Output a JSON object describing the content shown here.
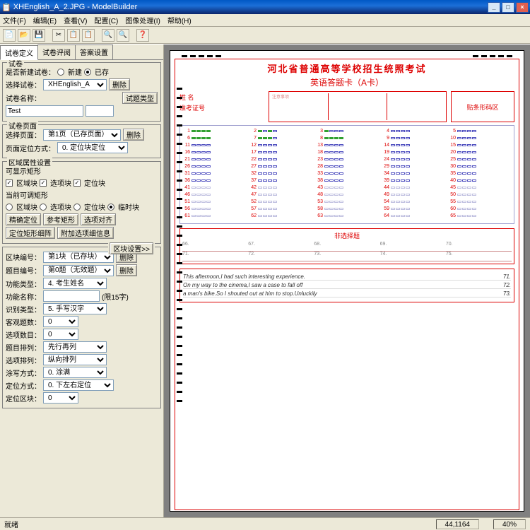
{
  "title": "XHEnglish_A_2.JPG - ModelBuilder",
  "menu": [
    "文件(F)",
    "编辑(E)",
    "查看(V)",
    "配置(C)",
    "图像处理(I)",
    "帮助(H)"
  ],
  "toolbar_icons": [
    "📄",
    "📂",
    "💾",
    "",
    "✂",
    "📋",
    "📋",
    "",
    "🔍",
    "🔍",
    "",
    "❓"
  ],
  "tabs": [
    "试卷定义",
    "试卷评阅",
    "答案设置"
  ],
  "active_tab": 0,
  "panel": {
    "g1": {
      "legend": "试卷",
      "l_new": "是否新建试卷：",
      "r_new": "新建",
      "r_exist": "已存",
      "l_sel": "选择试卷：",
      "sel": "XHEnglish_A",
      "btn_del": "删除",
      "l_name": "试卷名称：",
      "name": "Test",
      "btn_type": "试题类型"
    },
    "g2": {
      "legend": "试卷页面",
      "l_sel": "选择页面：",
      "sel": "第1页（已存页面）",
      "btn_del": "删除",
      "l_pos": "页面定位方式：",
      "pos": "0. 定位块定位"
    },
    "g3": {
      "legend": "区域属性设置",
      "l_show": "可显示矩形",
      "c1": "区域块",
      "c2": "选项块",
      "c3": "定位块",
      "l_adj": "当前可调矩形",
      "r1": "区域块",
      "r2": "选项块",
      "r3": "定位块",
      "r4": "临时块",
      "b1": "精确定位",
      "b2": "参考矩形",
      "b3": "选项对齐",
      "b4": "定位矩形细阵",
      "b5": "附加选项细信息"
    },
    "g4": {
      "btn_set": "区块设置>>",
      "l_block": "区块编号：",
      "block": "第1块（已存块）",
      "btn_del": "删除",
      "l_q": "题目编号：",
      "q": "第0题（无效题）",
      "btn_del2": "删除",
      "l_ftype": "功能类型：",
      "ftype": "4. 考生姓名",
      "l_fname": "功能名称：",
      "fhint": "(限15字)",
      "l_rec": "识别类型：",
      "rec": "5. 手写汉字",
      "l_ans": "客观题数：",
      "ans": "0",
      "l_opt": "选项数目：",
      "opt": "0",
      "l_arr": "题目排列：",
      "arr": "先行再列",
      "l_oarr": "选项排列：",
      "oarr": "纵向排列",
      "l_fill": "涂写方式：",
      "fill": "0. 涂满",
      "l_loc": "定位方式：",
      "loc": "0. 下左右定位",
      "l_lblk": "定位区块：",
      "lblk": "0"
    }
  },
  "sheet": {
    "title": "河北省普通高等学校招生统照考试",
    "subtitle": "英语答题卡（A卡）",
    "name_label": "姓    名",
    "id_label": "准考证号",
    "notice_title": "注意事项",
    "barcode": "贴条形码区",
    "essay_title": "非选择题",
    "essay_nums": [
      "66.",
      "67.",
      "68.",
      "69.",
      "70.",
      "71.",
      "72.",
      "73.",
      "74.",
      "75."
    ],
    "writing": [
      "This afternoon,I had such interesting experience.",
      "On my way to the cinema,I saw a case to fall off",
      "a man's bike.So I shouted out at him to stop.Unluckily"
    ],
    "writing_nums": [
      "71.",
      "72.",
      "73."
    ]
  },
  "status": {
    "left": "就绪",
    "coords": "44,1164",
    "zoom": "40%"
  }
}
